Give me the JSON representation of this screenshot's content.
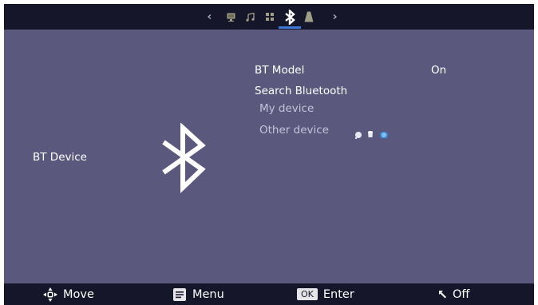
{
  "top_tabs": [
    "picture-icon",
    "sound-icon",
    "apps-icon",
    "bluetooth-icon",
    "lock-icon"
  ],
  "selected_tab": "bluetooth-icon",
  "accent_color": "#3b7bd6",
  "page": {
    "section_label": "BT Device"
  },
  "menu": {
    "bt_model_label": "BT Model",
    "bt_model_value": "On",
    "search_label": "Search Bluetooth",
    "my_device_label": "My device",
    "other_device_label": "Other device"
  },
  "footer": {
    "move_label": "Move",
    "menu_label": "Menu",
    "ok_key": "OK",
    "enter_label": "Enter",
    "off_label": "Off"
  }
}
